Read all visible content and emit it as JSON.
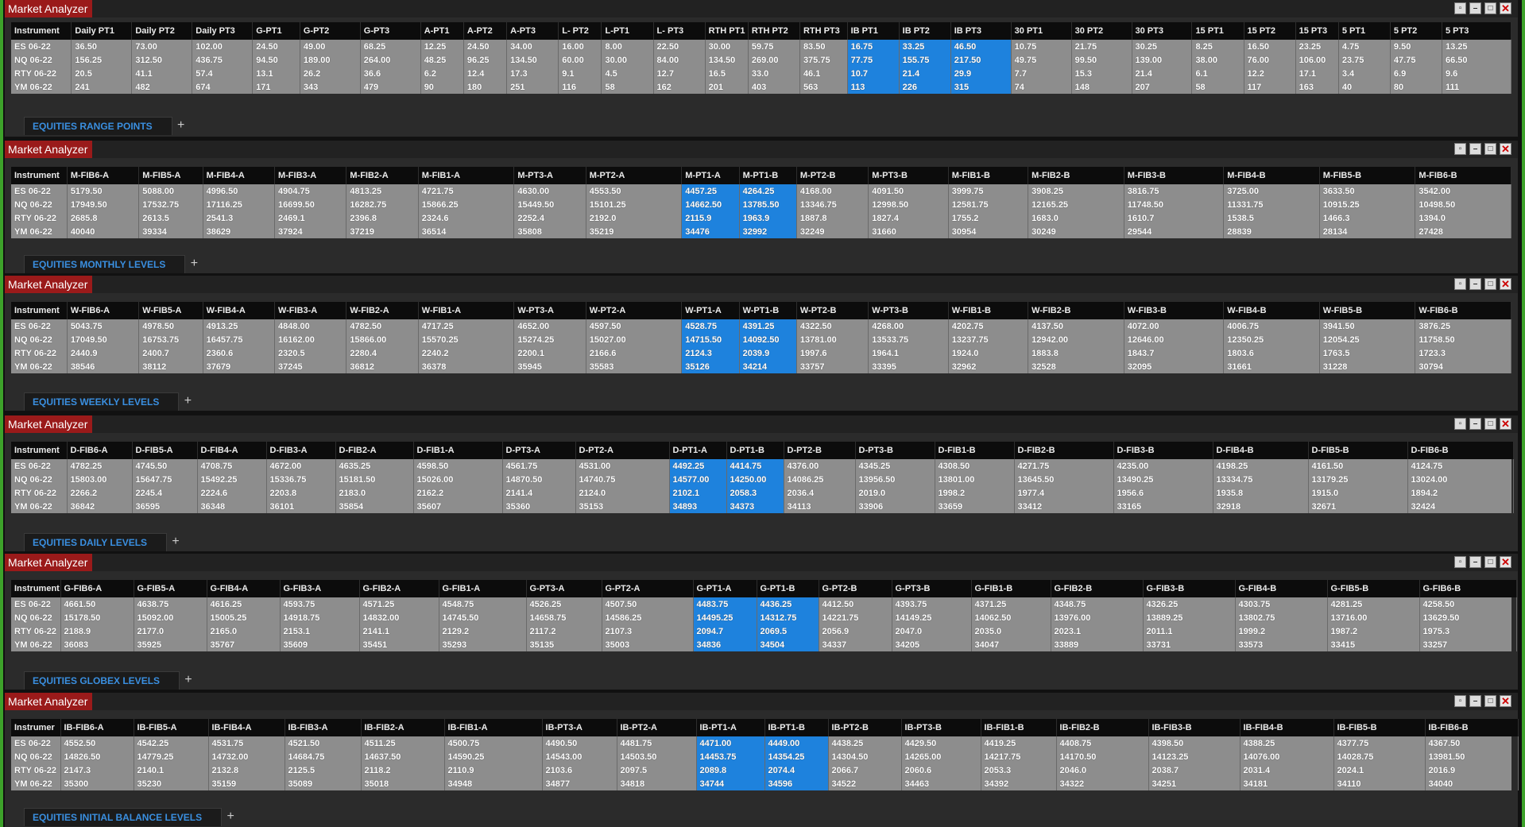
{
  "window_title": "Market Analyzer",
  "instruments": [
    "ES 06-22",
    "NQ 06-22",
    "RTY 06-22",
    "YM 06-22"
  ],
  "colors": {
    "highlight": "#1e82dd",
    "title_bg": "#9a1a1a",
    "tab_text": "#3a8fe0"
  },
  "panels": [
    {
      "id": "range",
      "tab_label": "EQUITIES RANGE POINTS",
      "columns": [
        "Instrument",
        "Daily PT1",
        "Daily PT2",
        "Daily PT3",
        "G-PT1",
        "G-PT2",
        "G-PT3",
        "A-PT1",
        "A-PT2",
        "A-PT3",
        "L- PT2",
        "L-PT1",
        "L- PT3",
        "RTH PT1",
        "RTH PT2",
        "RTH PT3",
        "IB PT1",
        "IB PT2",
        "IB PT3",
        "30 PT1",
        "30 PT2",
        "30 PT3",
        "15 PT1",
        "15 PT2",
        "15 PT3",
        "5 PT1",
        "5 PT2",
        "5 PT3"
      ],
      "widths": [
        70,
        70,
        70,
        70,
        55,
        70,
        70,
        50,
        50,
        60,
        50,
        60,
        60,
        50,
        60,
        55,
        60,
        60,
        70,
        70,
        70,
        70,
        60,
        60,
        50,
        60,
        60,
        80
      ],
      "highlight": [
        16,
        17,
        18
      ],
      "rows": [
        [
          "ES 06-22",
          "36.50",
          "73.00",
          "102.00",
          "24.50",
          "49.00",
          "68.25",
          "12.25",
          "24.50",
          "34.00",
          "16.00",
          "8.00",
          "22.50",
          "30.00",
          "59.75",
          "83.50",
          "16.75",
          "33.25",
          "46.50",
          "10.75",
          "21.75",
          "30.25",
          "8.25",
          "16.50",
          "23.25",
          "4.75",
          "9.50",
          "13.25"
        ],
        [
          "NQ 06-22",
          "156.25",
          "312.50",
          "436.75",
          "94.50",
          "189.00",
          "264.00",
          "48.25",
          "96.25",
          "134.50",
          "60.00",
          "30.00",
          "84.00",
          "134.50",
          "269.00",
          "375.75",
          "77.75",
          "155.75",
          "217.50",
          "49.75",
          "99.50",
          "139.00",
          "38.00",
          "76.00",
          "106.00",
          "23.75",
          "47.75",
          "66.50"
        ],
        [
          "RTY 06-22",
          "20.5",
          "41.1",
          "57.4",
          "13.1",
          "26.2",
          "36.6",
          "6.2",
          "12.4",
          "17.3",
          "9.1",
          "4.5",
          "12.7",
          "16.5",
          "33.0",
          "46.1",
          "10.7",
          "21.4",
          "29.9",
          "7.7",
          "15.3",
          "21.4",
          "6.1",
          "12.2",
          "17.1",
          "3.4",
          "6.9",
          "9.6"
        ],
        [
          "YM 06-22",
          "241",
          "482",
          "674",
          "171",
          "343",
          "479",
          "90",
          "180",
          "251",
          "116",
          "58",
          "162",
          "201",
          "403",
          "563",
          "113",
          "226",
          "315",
          "74",
          "148",
          "207",
          "58",
          "117",
          "163",
          "40",
          "80",
          "111"
        ]
      ]
    },
    {
      "id": "monthly",
      "tab_label": "EQUITIES MONTHLY LEVELS",
      "columns": [
        "Instrument",
        "M-FIB6-A",
        "M-FIB5-A",
        "M-FIB4-A",
        "M-FIB3-A",
        "M-FIB2-A",
        "M-FIB1-A",
        "M-PT3-A",
        "M-PT2-A",
        "M-PT1-A",
        "M-PT1-B",
        "M-PT2-B",
        "M-PT3-B",
        "M-FIB1-B",
        "M-FIB2-B",
        "M-FIB3-B",
        "M-FIB4-B",
        "M-FIB5-B",
        "M-FIB6-B"
      ],
      "widths": [
        70,
        90,
        80,
        90,
        90,
        90,
        120,
        90,
        120,
        72,
        72,
        90,
        100,
        100,
        120,
        125,
        120,
        120,
        120
      ],
      "highlight": [
        9,
        10
      ],
      "rows": [
        [
          "ES 06-22",
          "5179.50",
          "5088.00",
          "4996.50",
          "4904.75",
          "4813.25",
          "4721.75",
          "4630.00",
          "4553.50",
          "4457.25",
          "4264.25",
          "4168.00",
          "4091.50",
          "3999.75",
          "3908.25",
          "3816.75",
          "3725.00",
          "3633.50",
          "3542.00"
        ],
        [
          "NQ 06-22",
          "17949.50",
          "17532.75",
          "17116.25",
          "16699.50",
          "16282.75",
          "15866.25",
          "15449.50",
          "15101.25",
          "14662.50",
          "13785.50",
          "13346.75",
          "12998.50",
          "12581.75",
          "12165.25",
          "11748.50",
          "11331.75",
          "10915.25",
          "10498.50"
        ],
        [
          "RTY 06-22",
          "2685.8",
          "2613.5",
          "2541.3",
          "2469.1",
          "2396.8",
          "2324.6",
          "2252.4",
          "2192.0",
          "2115.9",
          "1963.9",
          "1887.8",
          "1827.4",
          "1755.2",
          "1683.0",
          "1610.7",
          "1538.5",
          "1466.3",
          "1394.0"
        ],
        [
          "YM 06-22",
          "40040",
          "39334",
          "38629",
          "37924",
          "37219",
          "36514",
          "35808",
          "35219",
          "34476",
          "32992",
          "32249",
          "31660",
          "30954",
          "30249",
          "29544",
          "28839",
          "28134",
          "27428"
        ]
      ]
    },
    {
      "id": "weekly",
      "tab_label": "EQUITIES WEEKLY LEVELS",
      "columns": [
        "Instrument",
        "W-FIB6-A",
        "W-FIB5-A",
        "W-FIB4-A",
        "W-FIB3-A",
        "W-FIB2-A",
        "W-FIB1-A",
        "W-PT3-A",
        "W-PT2-A",
        "W-PT1-A",
        "W-PT1-B",
        "W-PT2-B",
        "W-PT3-B",
        "W-FIB1-B",
        "W-FIB2-B",
        "W-FIB3-B",
        "W-FIB4-B",
        "W-FIB5-B",
        "W-FIB6-B"
      ],
      "widths": [
        70,
        90,
        80,
        90,
        90,
        90,
        120,
        90,
        120,
        72,
        72,
        90,
        100,
        100,
        120,
        125,
        120,
        120,
        120
      ],
      "highlight": [
        9,
        10
      ],
      "rows": [
        [
          "ES 06-22",
          "5043.75",
          "4978.50",
          "4913.25",
          "4848.00",
          "4782.50",
          "4717.25",
          "4652.00",
          "4597.50",
          "4528.75",
          "4391.25",
          "4322.50",
          "4268.00",
          "4202.75",
          "4137.50",
          "4072.00",
          "4006.75",
          "3941.50",
          "3876.25"
        ],
        [
          "NQ 06-22",
          "17049.50",
          "16753.75",
          "16457.75",
          "16162.00",
          "15866.00",
          "15570.25",
          "15274.25",
          "15027.00",
          "14715.50",
          "14092.50",
          "13781.00",
          "13533.75",
          "13237.75",
          "12942.00",
          "12646.00",
          "12350.25",
          "12054.25",
          "11758.50"
        ],
        [
          "RTY 06-22",
          "2440.9",
          "2400.7",
          "2360.6",
          "2320.5",
          "2280.4",
          "2240.2",
          "2200.1",
          "2166.6",
          "2124.3",
          "2039.9",
          "1997.6",
          "1964.1",
          "1924.0",
          "1883.8",
          "1843.7",
          "1803.6",
          "1763.5",
          "1723.3"
        ],
        [
          "YM 06-22",
          "38546",
          "38112",
          "37679",
          "37245",
          "36812",
          "36378",
          "35945",
          "35583",
          "35126",
          "34214",
          "33757",
          "33395",
          "32962",
          "32528",
          "32095",
          "31661",
          "31228",
          "30794"
        ]
      ]
    },
    {
      "id": "daily",
      "tab_label": "EQUITIES DAILY LEVELS",
      "columns": [
        "Instrument",
        "D-FIB6-A",
        "D-FIB5-A",
        "D-FIB4-A",
        "D-FIB3-A",
        "D-FIB2-A",
        "D-FIB1-A",
        "D-PT3-A",
        "D-PT2-A",
        "D-PT1-A",
        "D-PT1-B",
        "D-PT2-B",
        "D-PT3-B",
        "D-FIB1-B",
        "D-FIB2-B",
        "D-FIB3-B",
        "D-FIB4-B",
        "D-FIB5-B",
        "D-FIB6-B"
      ],
      "widths": [
        70,
        82,
        82,
        87,
        87,
        98,
        112,
        92,
        118,
        72,
        72,
        90,
        100,
        100,
        125,
        125,
        120,
        125,
        133
      ],
      "highlight": [
        9,
        10
      ],
      "rows": [
        [
          "ES 06-22",
          "4782.25",
          "4745.50",
          "4708.75",
          "4672.00",
          "4635.25",
          "4598.50",
          "4561.75",
          "4531.00",
          "4492.25",
          "4414.75",
          "4376.00",
          "4345.25",
          "4308.50",
          "4271.75",
          "4235.00",
          "4198.25",
          "4161.50",
          "4124.75"
        ],
        [
          "NQ 06-22",
          "15803.00",
          "15647.75",
          "15492.25",
          "15336.75",
          "15181.50",
          "15026.00",
          "14870.50",
          "14740.75",
          "14577.00",
          "14250.00",
          "14086.25",
          "13956.50",
          "13801.00",
          "13645.50",
          "13490.25",
          "13334.75",
          "13179.25",
          "13024.00"
        ],
        [
          "RTY 06-22",
          "2266.2",
          "2245.4",
          "2224.6",
          "2203.8",
          "2183.0",
          "2162.2",
          "2141.4",
          "2124.0",
          "2102.1",
          "2058.3",
          "2036.4",
          "2019.0",
          "1998.2",
          "1977.4",
          "1956.6",
          "1935.8",
          "1915.0",
          "1894.2"
        ],
        [
          "YM 06-22",
          "36842",
          "36595",
          "36348",
          "36101",
          "35854",
          "35607",
          "35360",
          "35153",
          "34893",
          "34373",
          "34113",
          "33906",
          "33659",
          "33412",
          "33165",
          "32918",
          "32671",
          "32424"
        ]
      ]
    },
    {
      "id": "globex",
      "tab_label": "EQUITIES GLOBEX LEVELS",
      "columns": [
        "Instrument",
        "G-FIB6-A",
        "G-FIB5-A",
        "G-FIB4-A",
        "G-FIB3-A",
        "G-FIB2-A",
        "G-FIB1-A",
        "G-PT3-A",
        "G-PT2-A",
        "G-PT1-A",
        "G-PT1-B",
        "G-PT2-B",
        "G-PT3-B",
        "G-FIB1-B",
        "G-FIB2-B",
        "G-FIB3-B",
        "G-FIB4-B",
        "G-FIB5-B",
        "G-FIB6-B"
      ],
      "widths": [
        62,
        92,
        92,
        92,
        100,
        100,
        110,
        95,
        115,
        80,
        78,
        92,
        100,
        100,
        116,
        116,
        116,
        116,
        122
      ],
      "highlight": [
        9,
        10
      ],
      "rows": [
        [
          "ES 06-22",
          "4661.50",
          "4638.75",
          "4616.25",
          "4593.75",
          "4571.25",
          "4548.75",
          "4526.25",
          "4507.50",
          "4483.75",
          "4436.25",
          "4412.50",
          "4393.75",
          "4371.25",
          "4348.75",
          "4326.25",
          "4303.75",
          "4281.25",
          "4258.50"
        ],
        [
          "NQ 06-22",
          "15178.50",
          "15092.00",
          "15005.25",
          "14918.75",
          "14832.00",
          "14745.50",
          "14658.75",
          "14586.25",
          "14495.25",
          "14312.75",
          "14221.75",
          "14149.25",
          "14062.50",
          "13976.00",
          "13889.25",
          "13802.75",
          "13716.00",
          "13629.50"
        ],
        [
          "RTY 06-22",
          "2188.9",
          "2177.0",
          "2165.0",
          "2153.1",
          "2141.1",
          "2129.2",
          "2117.2",
          "2107.3",
          "2094.7",
          "2069.5",
          "2056.9",
          "2047.0",
          "2035.0",
          "2023.1",
          "2011.1",
          "1999.2",
          "1987.2",
          "1975.3"
        ],
        [
          "YM 06-22",
          "36083",
          "35925",
          "35767",
          "35609",
          "35451",
          "35293",
          "35135",
          "35003",
          "34836",
          "34504",
          "34337",
          "34205",
          "34047",
          "33889",
          "33731",
          "33573",
          "33415",
          "33257"
        ]
      ]
    },
    {
      "id": "ib",
      "tab_label": "EQUITIES INITIAL BALANCE LEVELS",
      "columns": [
        "Instrumer",
        "IB-FIB6-A",
        "IB-FIB5-A",
        "IB-FIB4-A",
        "IB-FIB3-A",
        "IB-FIB2-A",
        "IB-FIB1-A",
        "IB-PT3-A",
        "IB-PT2-A",
        "IB-PT1-A",
        "IB-PT1-B",
        "IB-PT2-B",
        "IB-PT3-B",
        "IB-FIB1-B",
        "IB-FIB2-B",
        "IB-FIB3-B",
        "IB-FIB4-B",
        "IB-FIB5-B",
        "IB-FIB6-B"
      ],
      "widths": [
        62,
        92,
        94,
        96,
        96,
        105,
        123,
        94,
        100,
        86,
        80,
        92,
        100,
        95,
        116,
        115,
        118,
        115,
        117
      ],
      "highlight": [
        9,
        10
      ],
      "rows": [
        [
          "ES 06-22",
          "4552.50",
          "4542.25",
          "4531.75",
          "4521.50",
          "4511.25",
          "4500.75",
          "4490.50",
          "4481.75",
          "4471.00",
          "4449.00",
          "4438.25",
          "4429.50",
          "4419.25",
          "4408.75",
          "4398.50",
          "4388.25",
          "4377.75",
          "4367.50"
        ],
        [
          "NQ 06-22",
          "14826.50",
          "14779.25",
          "14732.00",
          "14684.75",
          "14637.50",
          "14590.25",
          "14543.00",
          "14503.50",
          "14453.75",
          "14354.25",
          "14304.50",
          "14265.00",
          "14217.75",
          "14170.50",
          "14123.25",
          "14076.00",
          "14028.75",
          "13981.50"
        ],
        [
          "RTY 06-22",
          "2147.3",
          "2140.1",
          "2132.8",
          "2125.5",
          "2118.2",
          "2110.9",
          "2103.6",
          "2097.5",
          "2089.8",
          "2074.4",
          "2066.7",
          "2060.6",
          "2053.3",
          "2046.0",
          "2038.7",
          "2031.4",
          "2024.1",
          "2016.9"
        ],
        [
          "YM 06-22",
          "35300",
          "35230",
          "35159",
          "35089",
          "35018",
          "34948",
          "34877",
          "34818",
          "34744",
          "34596",
          "34522",
          "34463",
          "34392",
          "34322",
          "34251",
          "34181",
          "34110",
          "34040"
        ]
      ]
    }
  ]
}
